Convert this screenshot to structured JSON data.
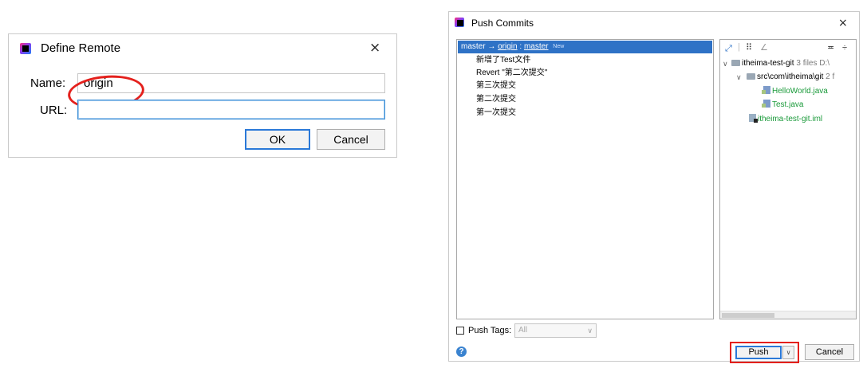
{
  "define_remote": {
    "title": "Define Remote",
    "close": "×",
    "name_label": "Name:",
    "name_value": "origin",
    "url_label": "URL:",
    "url_value": "",
    "ok_label": "OK",
    "cancel_label": "Cancel"
  },
  "push_commits": {
    "title": "Push Commits",
    "close": "×",
    "branch": {
      "local": "master",
      "arrow": "→",
      "remote": "origin",
      "sep": ":",
      "remote_branch": "master",
      "badge": "New"
    },
    "commits": [
      "新增了Test文件",
      "Revert \"第二次提交\"",
      "第三次提交",
      "第二次提交",
      "第一次提交"
    ],
    "tree": {
      "project": "itheima-test-git",
      "project_meta": "3 files D:\\",
      "package": "src\\com\\itheima\\git",
      "package_meta": "2 f",
      "files": [
        "HelloWorld.java",
        "Test.java"
      ],
      "module_file": "itheima-test-git.iml"
    },
    "push_tags_label": "Push Tags:",
    "push_tags_value": "All",
    "push_label": "Push",
    "cancel_label": "Cancel",
    "help": "?"
  },
  "icons": {
    "chevron_down": "∨",
    "dropdown_arrow": "∨"
  },
  "colors": {
    "selection": "#2e72c6",
    "highlight_red": "#e4201c",
    "focus_blue": "#2b79d8",
    "added_file_green": "#1a9a3a"
  }
}
